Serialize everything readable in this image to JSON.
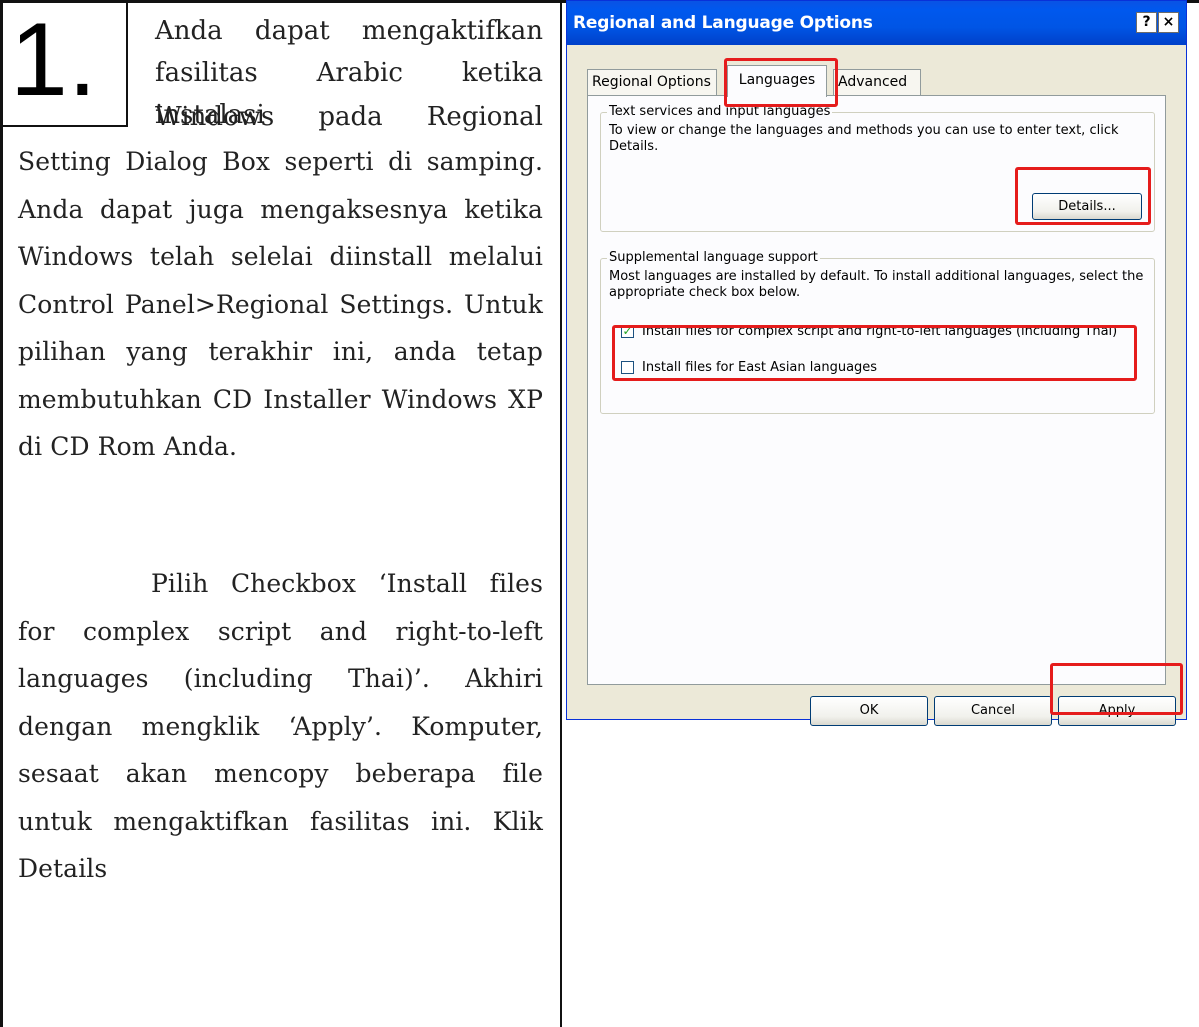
{
  "step": {
    "number": "1."
  },
  "left_text": {
    "line1": "Anda dapat mengaktifkan",
    "line2": "fasilitas Arabic ketika instalasi",
    "line3": "Windows pada Regional",
    "paragraph1_rest": "Setting Dialog Box seperti di samping. Anda dapat juga mengaksesnya ketika Windows telah selelai diinstall melalui Control Panel>Regional Settings. Untuk pilihan yang terakhir ini, anda tetap membutuhkan CD Installer Windows XP di CD Rom Anda.",
    "paragraph2": "Pilih Checkbox ‘Install files for complex script and right-to-left languages (including Thai)’. Akhiri dengan mengklik ‘Apply’. Komputer, sesaat akan mencopy beberapa file untuk mengaktifkan fasilitas ini. Klik Details"
  },
  "dialog": {
    "title": "Regional and Language Options",
    "help_label": "?",
    "close_label": "×",
    "tabs": [
      {
        "label": "Regional Options"
      },
      {
        "label": "Languages"
      },
      {
        "label": "Advanced"
      }
    ],
    "active_tab": "Languages",
    "text_services": {
      "title": "Text services and input languages",
      "description": "To view or change the languages and methods you can use to enter text, click Details.",
      "details_label": "Details..."
    },
    "supplemental": {
      "title": "Supplemental language support",
      "description": "Most languages are installed by default. To install additional languages, select the appropriate check box below.",
      "complex_script": {
        "label": "Install files for complex script and right-to-left languages (including Thai)",
        "checked": true,
        "mark": "✓"
      },
      "east_asian": {
        "label": "Install files for East Asian languages",
        "checked": false,
        "mark": ""
      }
    },
    "buttons": {
      "ok": "OK",
      "cancel": "Cancel",
      "apply": "Apply"
    }
  },
  "colors": {
    "highlight": "#e51c1c",
    "titlebar": "#0058ee",
    "dialog_bg": "#ece9d8",
    "tab_panel_bg": "#fcfcfe"
  }
}
